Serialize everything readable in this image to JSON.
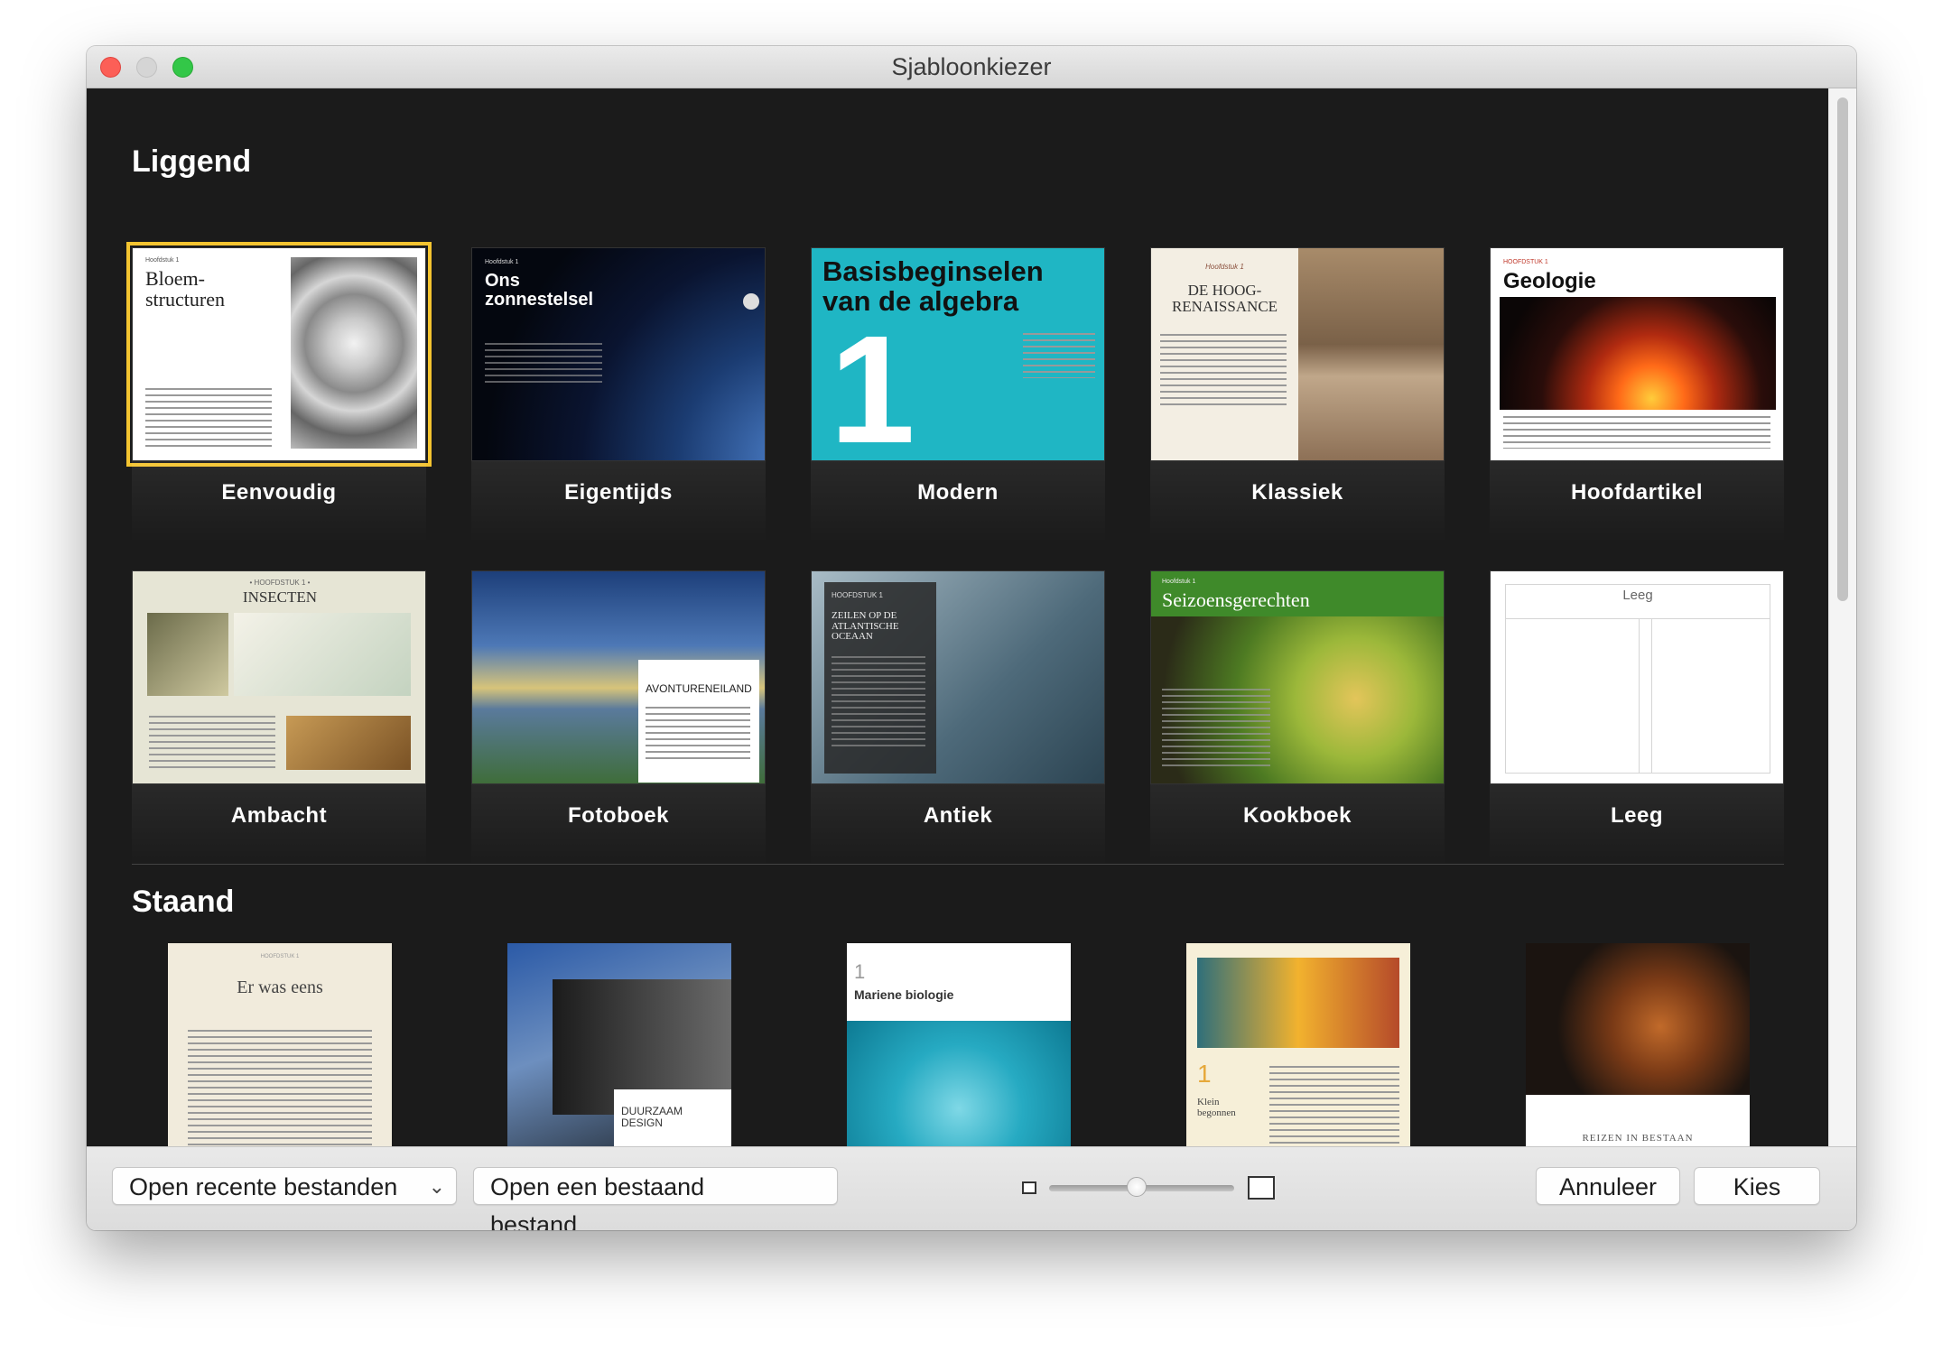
{
  "window": {
    "title": "Sjabloonkiezer"
  },
  "sections": {
    "landscape": "Liggend",
    "portrait": "Staand"
  },
  "landscape_templates": [
    {
      "label": "Eenvoudig",
      "selected": true,
      "thumb": {
        "kicker": "Hoofdstuk 1",
        "title": "Bloem-\nstructuren"
      }
    },
    {
      "label": "Eigentijds",
      "selected": false,
      "thumb": {
        "kicker": "Hoofdstuk 1",
        "title": "Ons\nzonnestelsel"
      }
    },
    {
      "label": "Modern",
      "selected": false,
      "thumb": {
        "title": "Basisbeginselen\nvan de algebra",
        "number": "1"
      }
    },
    {
      "label": "Klassiek",
      "selected": false,
      "thumb": {
        "kicker": "Hoofdstuk 1",
        "title": "DE HOOG-\nRENAISSANCE"
      }
    },
    {
      "label": "Hoofdartikel",
      "selected": false,
      "thumb": {
        "kicker": "HOOFDSTUK 1",
        "title": "Geologie"
      }
    },
    {
      "label": "Ambacht",
      "selected": false,
      "thumb": {
        "kicker": "• HOOFDSTUK 1 •",
        "title": "INSECTEN"
      }
    },
    {
      "label": "Fotoboek",
      "selected": false,
      "thumb": {
        "title": "AVONTURENEILAND"
      }
    },
    {
      "label": "Antiek",
      "selected": false,
      "thumb": {
        "kicker": "HOOFDSTUK 1",
        "title": "ZEILEN OP DE\nATLANTISCHE\nOCEAAN"
      }
    },
    {
      "label": "Kookboek",
      "selected": false,
      "thumb": {
        "kicker": "Hoofdstuk 1",
        "title": "Seizoensgerechten"
      }
    },
    {
      "label": "Leeg",
      "selected": false,
      "thumb": {
        "title": "Leeg"
      }
    }
  ],
  "portrait_templates": [
    {
      "title": "Er was eens",
      "kicker": "HOOFDSTUK 1"
    },
    {
      "title": "DUURZAAM\nDESIGN"
    },
    {
      "title": "Mariene biologie",
      "number": "1"
    },
    {
      "title": "Klein\nbegonnen",
      "number": "1"
    },
    {
      "title": "REIZEN IN BESTAAN"
    }
  ],
  "toolbar": {
    "recent_label": "Open recente bestanden",
    "open_label": "Open een bestaand bestand…",
    "cancel_label": "Annuleer",
    "choose_label": "Kies"
  },
  "slider": {
    "value": 0.4
  },
  "colors": {
    "selection": "#f4c430",
    "modern_teal": "#1fb6c4",
    "background": "#1b1b1b"
  }
}
